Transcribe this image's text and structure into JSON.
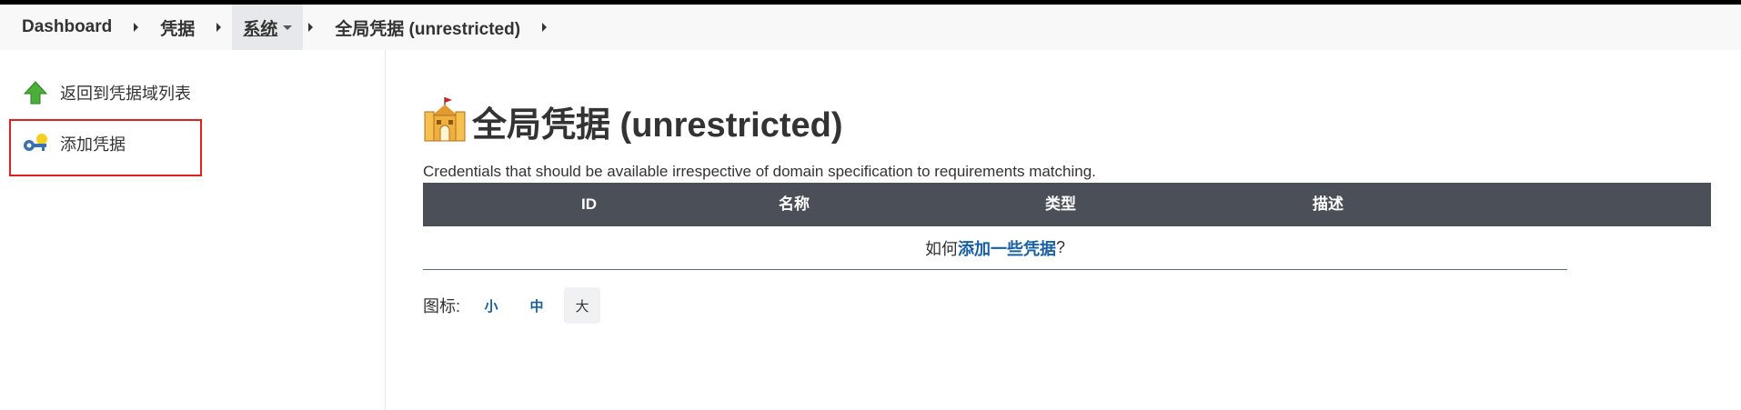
{
  "breadcrumb": {
    "items": [
      "Dashboard",
      "凭据",
      "系统",
      "全局凭据 (unrestricted)"
    ]
  },
  "sidebar": {
    "items": [
      {
        "label": "返回到凭据域列表",
        "icon": "arrow-up-icon"
      },
      {
        "label": "添加凭据",
        "icon": "key-icon"
      }
    ]
  },
  "page": {
    "title": "全局凭据 (unrestricted)",
    "description": "Credentials that should be available irrespective of domain specification to requirements matching."
  },
  "table": {
    "headers": [
      "ID",
      "名称",
      "类型",
      "描述"
    ],
    "empty_prefix": "如何",
    "empty_link": "添加一些凭据",
    "empty_suffix": "?"
  },
  "icon_size": {
    "label": "图标:",
    "options": [
      "小",
      "中",
      "大"
    ],
    "selected": "大"
  },
  "colors": {
    "table_header": "#4b5058",
    "link": "#1a5fa0",
    "highlight": "#e02020"
  }
}
